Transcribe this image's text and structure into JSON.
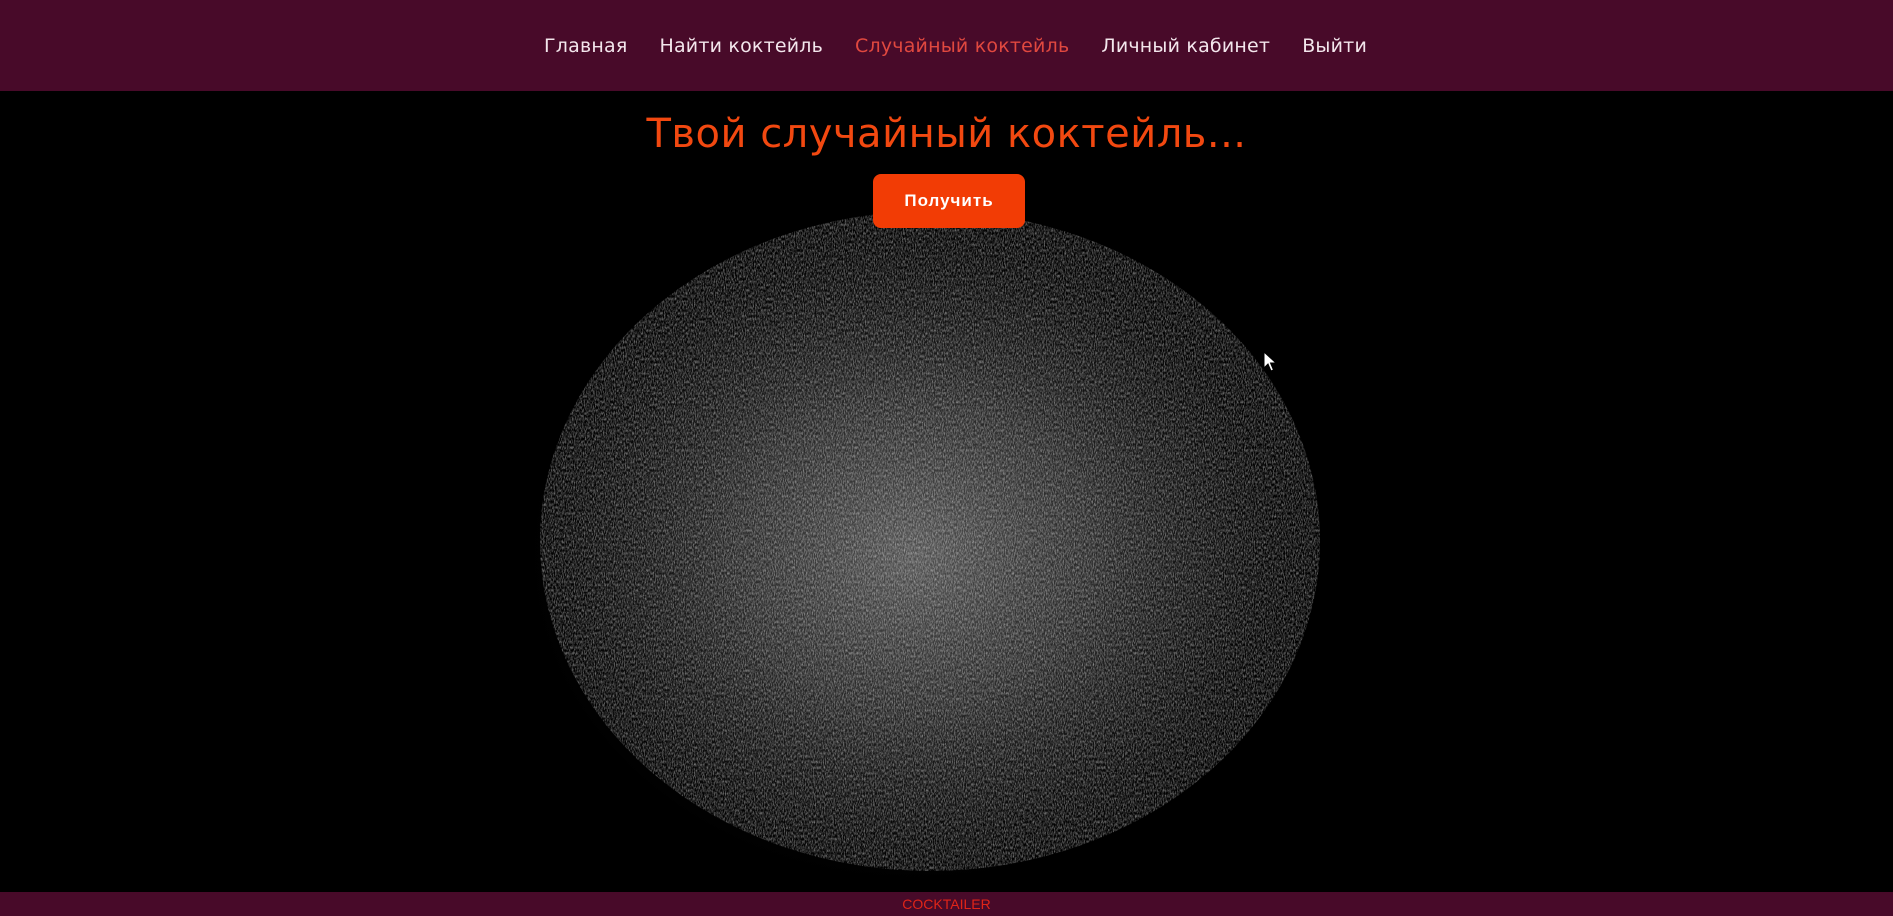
{
  "nav": {
    "items": [
      {
        "label": "Главная",
        "active": false
      },
      {
        "label": "Найти коктейль",
        "active": false
      },
      {
        "label": "Случайный коктейль",
        "active": true
      },
      {
        "label": "Личный кабинет",
        "active": false
      },
      {
        "label": "Выйти",
        "active": false
      }
    ]
  },
  "main": {
    "heading": "Твой случайный коктейль...",
    "button_label": "Получить"
  },
  "footer": {
    "brand": "COCKTAILER"
  },
  "colors": {
    "nav_bg": "#480a29",
    "accent": "#f24810",
    "active_link": "#e0483f",
    "button_bg": "#f23c05",
    "background": "#000000"
  },
  "icons": {
    "cursor": "mouse-pointer-icon"
  }
}
